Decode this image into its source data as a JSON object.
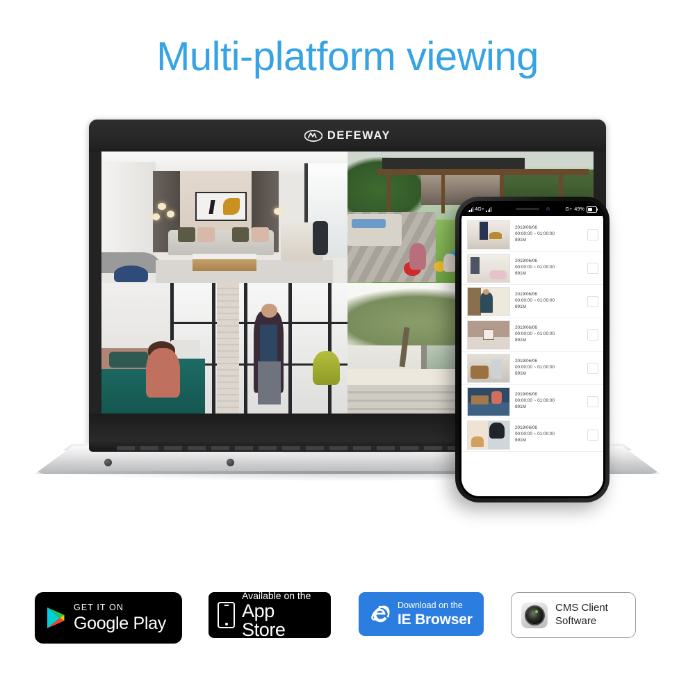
{
  "page": {
    "headline": "Multi-platform viewing",
    "headline_color": "#36A3E3",
    "background_color": "#FFFFFF"
  },
  "laptop": {
    "brand_name": "DEFEWAY",
    "brand_logo_icon": "defeway-logo-icon",
    "screen_layout": "2x2 quad view",
    "channels": [
      {
        "id": "ch1",
        "scene": "modern living room interior",
        "position": "top-left"
      },
      {
        "id": "ch2",
        "scene": "backyard garden with family playing",
        "position": "top-right"
      },
      {
        "id": "ch3",
        "scene": "loft bedroom with couple",
        "position": "bottom-left"
      },
      {
        "id": "ch4",
        "scene": "modern house exterior with trees",
        "position": "bottom-right"
      }
    ]
  },
  "phone": {
    "status_bar": {
      "carrier_signal_icon": "signal-bars-icon",
      "network_label": "4G+",
      "network_label_right": "4G+",
      "battery_percent": "49%",
      "battery_icon": "battery-icon",
      "notch_speaker_icon": "speaker-grille-icon",
      "notch_camera_icon": "front-camera-icon"
    },
    "recordings": [
      {
        "date": "2019/06/06",
        "time_range": "00:00:00 ~ 01:00:00",
        "size": "891M",
        "checked": false,
        "thumb": "t1"
      },
      {
        "date": "2019/06/06",
        "time_range": "00:00:00 ~ 01:00:00",
        "size": "891M",
        "checked": false,
        "thumb": "t2"
      },
      {
        "date": "2019/06/06",
        "time_range": "00:00:00 ~ 01:00:00",
        "size": "891M",
        "checked": false,
        "thumb": "t3"
      },
      {
        "date": "2019/06/06",
        "time_range": "00:00:00 ~ 01:00:00",
        "size": "891M",
        "checked": false,
        "thumb": "t4"
      },
      {
        "date": "2019/06/06",
        "time_range": "00:00:00 ~ 01:00:00",
        "size": "891M",
        "checked": false,
        "thumb": "t5"
      },
      {
        "date": "2019/06/06",
        "time_range": "00:00:00 ~ 01:00:00",
        "size": "891M",
        "checked": false,
        "thumb": "t6"
      },
      {
        "date": "2019/06/06",
        "time_range": "00:00:00 ~ 01:00:00",
        "size": "891M",
        "checked": false,
        "thumb": "t7"
      }
    ]
  },
  "badges": {
    "google_play": {
      "small_label": "GET IT ON",
      "big_label": "Google Play",
      "icon": "google-play-triangle-icon",
      "background": "#000000"
    },
    "app_store": {
      "small_label": "Available on the",
      "big_label": "App Store",
      "icon": "iphone-icon",
      "background": "#000000"
    },
    "ie_browser": {
      "small_label": "Download on the",
      "big_label": "IE Browser",
      "icon": "internet-explorer-icon",
      "background": "#2B7DE0"
    },
    "cms_client": {
      "label": "CMS Client Software",
      "icon": "camera-lens-icon",
      "background": "#FFFFFF"
    }
  }
}
